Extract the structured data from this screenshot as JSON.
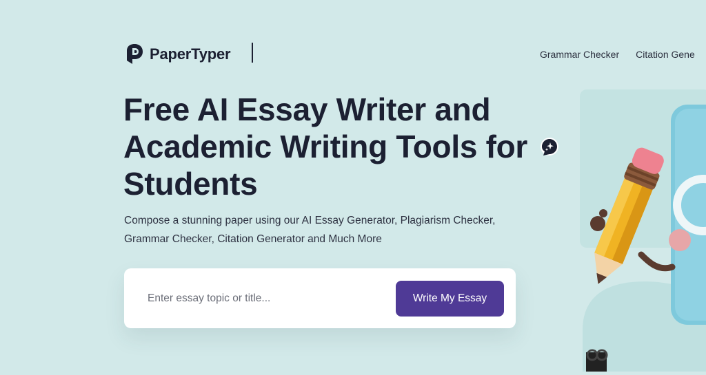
{
  "header": {
    "logo_text": "PaperTyper",
    "nav": [
      {
        "label": "Grammar Checker"
      },
      {
        "label": "Citation Gene"
      }
    ]
  },
  "hero": {
    "title_lines": [
      "Free AI Essay Writer and",
      "Academic Writing Tools for",
      "Students"
    ],
    "subtitle_lines": [
      "Compose a stunning paper using our AI Essay Generator, Plagiarism Checker,",
      "Grammar Checker, Citation Generator and Much More"
    ]
  },
  "search": {
    "placeholder": "Enter essay topic or title...",
    "value": "",
    "button_label": "Write My Essay"
  },
  "icons": {
    "logo": "papertyper-logo-icon",
    "chat": "ai-chat-bubble-icon",
    "illustration": "pencil-robot-illustration"
  },
  "colors": {
    "background": "#d2e9e9",
    "primary_text": "#1c2032",
    "accent_button": "#4f3a96",
    "card": "#ffffff"
  }
}
